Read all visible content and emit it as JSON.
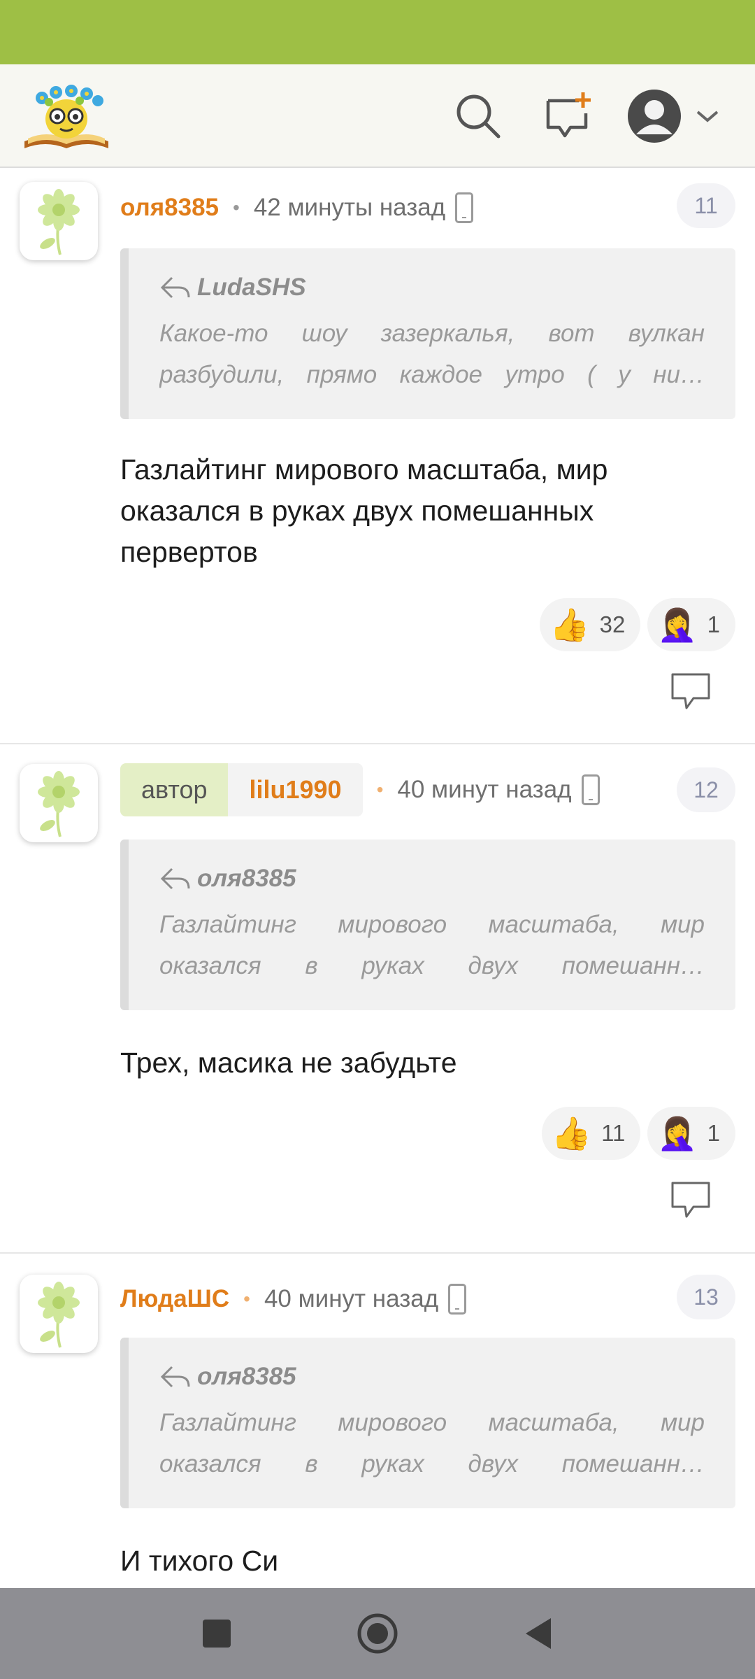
{
  "colors": {
    "statusbar": "#9ebf45",
    "author": "#e07d1a",
    "navbar": "#8e8e93"
  },
  "header": {
    "logo": "reading-bee-logo",
    "icons": [
      "search-icon",
      "new-post-icon",
      "user-avatar-icon",
      "chevron-down-icon"
    ]
  },
  "comments": [
    {
      "author": "оля8385",
      "time": "42 минуты назад",
      "number": "11",
      "reply_to": "LudaSHS",
      "quote": "Какое-то шоу зазеркалья, вот вулкан разбудили, прямо каждое утро ( у ни…",
      "text": "Газлайтинг мирового масштаба, мир оказался в руках двух помешанных первертов",
      "likes": "32",
      "facepalm": "1"
    },
    {
      "badge": "автор",
      "author": "lilu1990",
      "time": "40 минут назад",
      "number": "12",
      "reply_to": "оля8385",
      "quote": "Газлайтинг мирового масштаба, мир оказался в руках двух помешанн…",
      "text": "Трех, масика не забудьте",
      "likes": "11",
      "facepalm": "1"
    },
    {
      "author": "ЛюдаШС",
      "time": "40 минут назад",
      "number": "13",
      "reply_to": "оля8385",
      "quote": "Газлайтинг мирового масштаба, мир оказался в руках двух помешанн…",
      "text": "И тихого Си"
    }
  ],
  "emoji": {
    "like": "👍",
    "facepalm": "🤦‍♀️"
  }
}
